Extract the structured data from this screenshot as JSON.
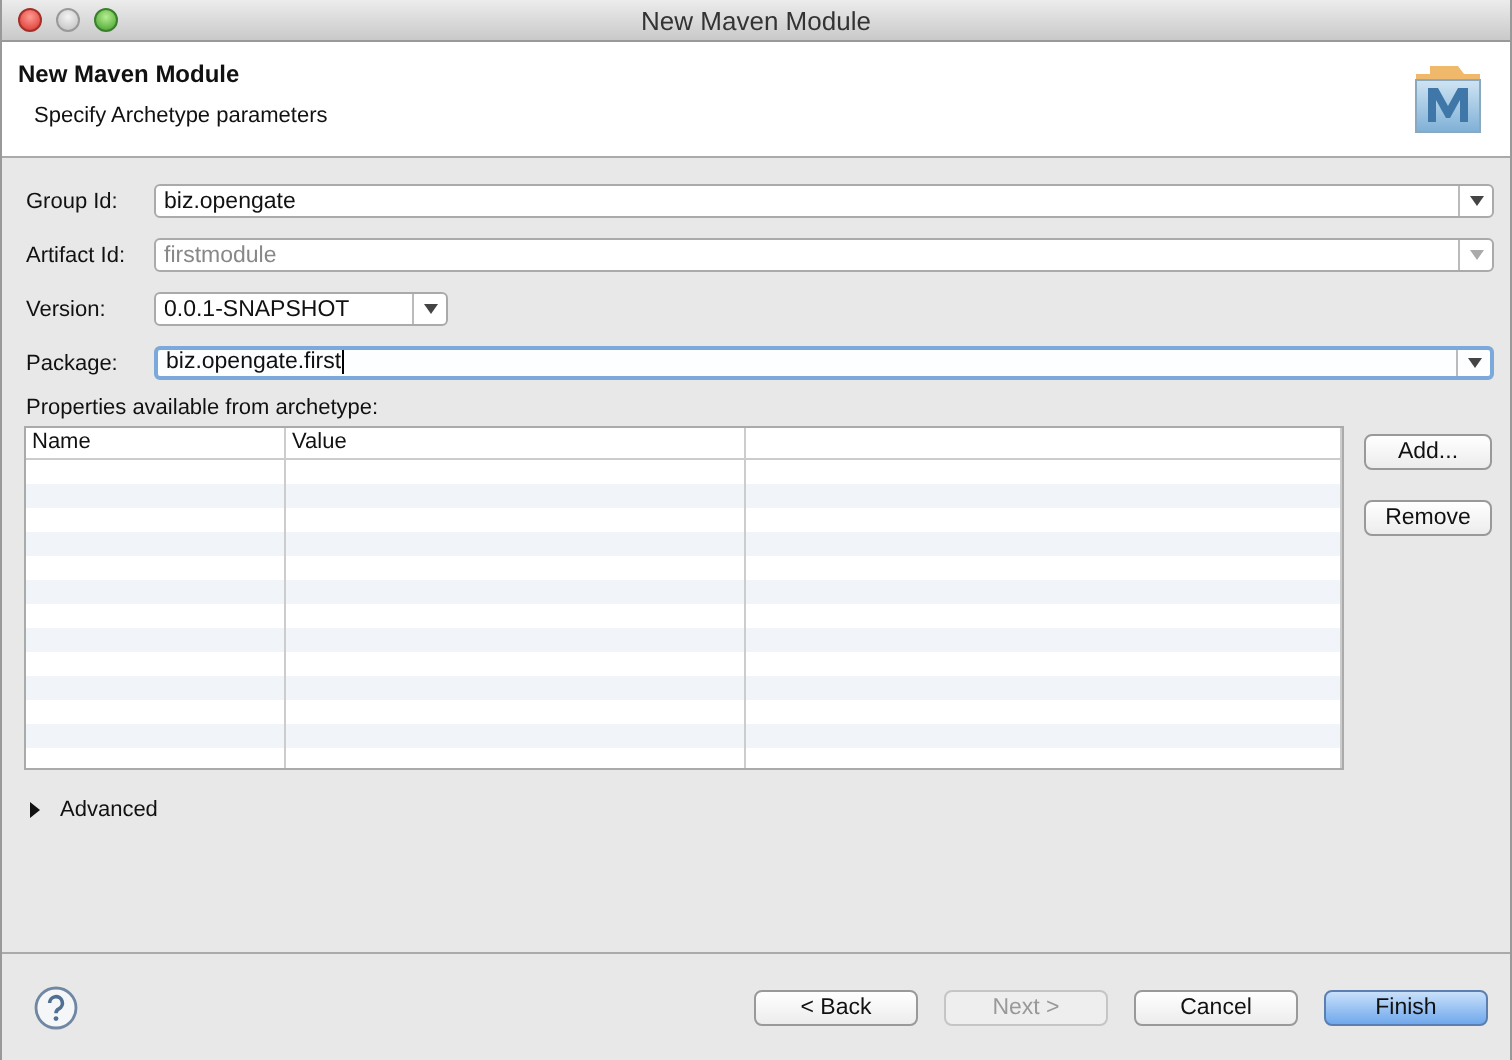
{
  "window": {
    "title": "New Maven Module"
  },
  "header": {
    "title": "New Maven Module",
    "subtitle": "Specify Archetype parameters"
  },
  "fields": [
    {
      "label": "Group Id:",
      "value": "biz.opengate",
      "kind": "combo",
      "disabled": false,
      "focused": false,
      "wide": true
    },
    {
      "label": "Artifact Id:",
      "value": "firstmodule",
      "kind": "combo",
      "disabled": true,
      "focused": false,
      "wide": true
    },
    {
      "label": "Version:",
      "value": "0.0.1-SNAPSHOT",
      "kind": "combo",
      "disabled": false,
      "focused": false,
      "wide": false
    },
    {
      "label": "Package:",
      "value": "biz.opengate.first",
      "kind": "combo",
      "disabled": false,
      "focused": true,
      "wide": true
    }
  ],
  "properties": {
    "label": "Properties available from archetype:",
    "columns": [
      "Name",
      "Value"
    ],
    "buttons": [
      {
        "label": "Add...",
        "disabled": false
      },
      {
        "label": "Remove",
        "disabled": false
      }
    ]
  },
  "advanced": {
    "label": "Advanced",
    "expanded": false
  },
  "buttons": [
    {
      "label": "< Back",
      "disabled": false,
      "default": false
    },
    {
      "label": "Next >",
      "disabled": true,
      "default": false
    },
    {
      "label": "Cancel",
      "disabled": false,
      "default": false
    },
    {
      "label": "Finish",
      "disabled": false,
      "default": true
    }
  ]
}
